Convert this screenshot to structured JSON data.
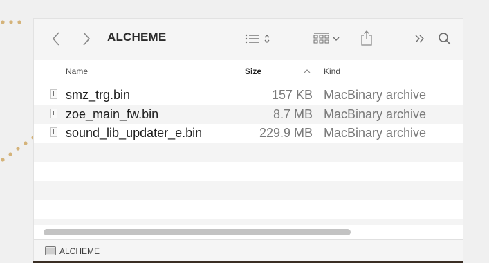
{
  "toolbar": {
    "title": "ALCHEME",
    "back_icon": "chevron-left-icon",
    "forward_icon": "chevron-right-icon",
    "list_view_icon": "list-view-icon",
    "group_icon": "icon-grid-icon",
    "share_icon": "share-icon",
    "more_icon": "double-chevron-icon",
    "search_icon": "search-icon"
  },
  "columns": {
    "name": "Name",
    "size": "Size",
    "kind": "Kind"
  },
  "files": [
    {
      "name": "smz_trg.bin",
      "size": "157 KB",
      "kind": "MacBinary archive"
    },
    {
      "name": "zoe_main_fw.bin",
      "size": "8.7 MB",
      "kind": "MacBinary archive"
    },
    {
      "name": "sound_lib_updater_e.bin",
      "size": "229.9 MB",
      "kind": "MacBinary archive"
    }
  ],
  "path_bar": {
    "folder": "ALCHEME"
  },
  "colors": {
    "annotation": "#c9a15a",
    "toolbar_bg": "#f5f5f5",
    "alt_row": "#f4f4f4"
  }
}
